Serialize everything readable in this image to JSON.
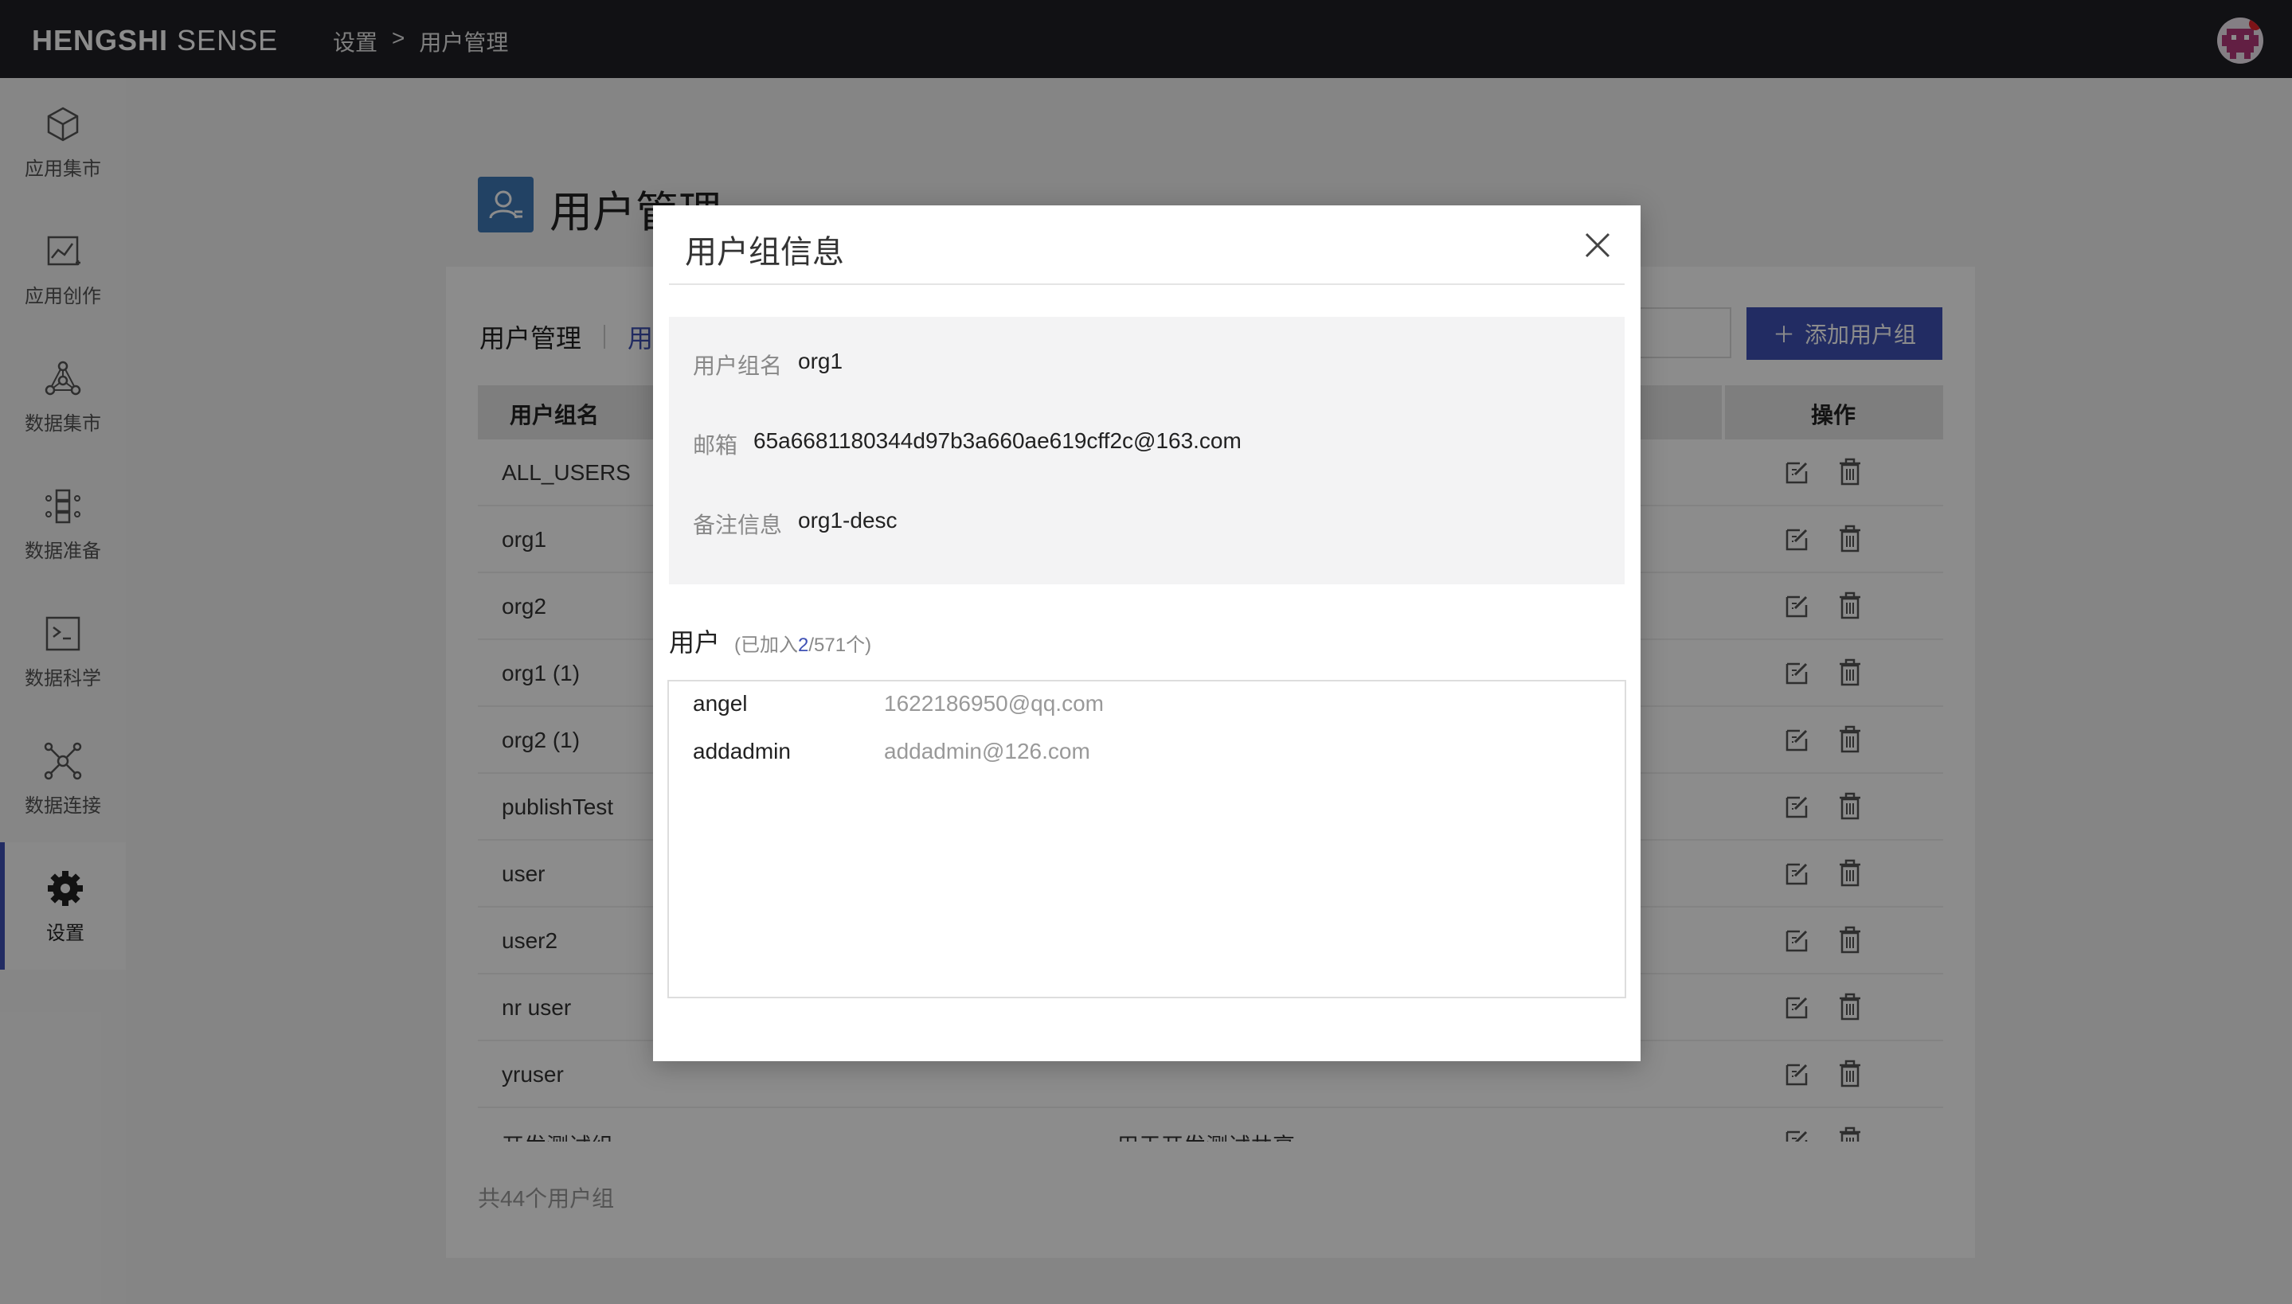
{
  "header": {
    "brand_bold": "HENGSHI",
    "brand_light": "SENSE",
    "breadcrumb": [
      "设置",
      ">",
      "用户管理"
    ]
  },
  "sidebar": {
    "items": [
      {
        "label": "应用集市",
        "icon": "cube-icon"
      },
      {
        "label": "应用创作",
        "icon": "chart-edit-icon"
      },
      {
        "label": "数据集市",
        "icon": "network-icon"
      },
      {
        "label": "数据准备",
        "icon": "data-prep-icon"
      },
      {
        "label": "数据科学",
        "icon": "terminal-icon"
      },
      {
        "label": "数据连接",
        "icon": "connection-icon"
      },
      {
        "label": "设置",
        "icon": "gear-icon",
        "active": true
      }
    ]
  },
  "page": {
    "title": "用户管理",
    "tab_users": "用户管理",
    "tab_groups": "用",
    "add_group_label": "添加用户组",
    "col_name": "用户组名",
    "col_ops": "操作",
    "rows": [
      {
        "name": "ALL_USERS",
        "desc": ""
      },
      {
        "name": "org1",
        "desc": ""
      },
      {
        "name": "org2",
        "desc": ""
      },
      {
        "name": "org1 (1)",
        "desc": ""
      },
      {
        "name": "org2 (1)",
        "desc": ""
      },
      {
        "name": "publishTest",
        "desc": ""
      },
      {
        "name": "user",
        "desc": ""
      },
      {
        "name": "user2",
        "desc": ""
      },
      {
        "name": "nr user",
        "desc": ""
      },
      {
        "name": "yruser",
        "desc": ""
      },
      {
        "name": "开发测试组",
        "desc": "用于开发测试共享app"
      }
    ],
    "total": "共44个用户组"
  },
  "modal": {
    "title": "用户组信息",
    "info": {
      "name_label": "用户组名",
      "name_value": "org1",
      "email_label": "邮箱",
      "email_value": "65a6681180344d97b3a660ae619cff2c@163.com",
      "note_label": "备注信息",
      "note_value": "org1-desc"
    },
    "users_title": "用户",
    "users_count_prefix": "(已加入",
    "users_count_joined": "2",
    "users_count_suffix": "/571个)",
    "users": [
      {
        "name": "angel",
        "email": "1622186950@qq.com"
      },
      {
        "name": "addadmin",
        "email": "addadmin@126.com"
      }
    ]
  },
  "colors": {
    "accent": "#3f51b5",
    "topbar": "#1f1f26",
    "title_icon": "#3f78b6"
  }
}
